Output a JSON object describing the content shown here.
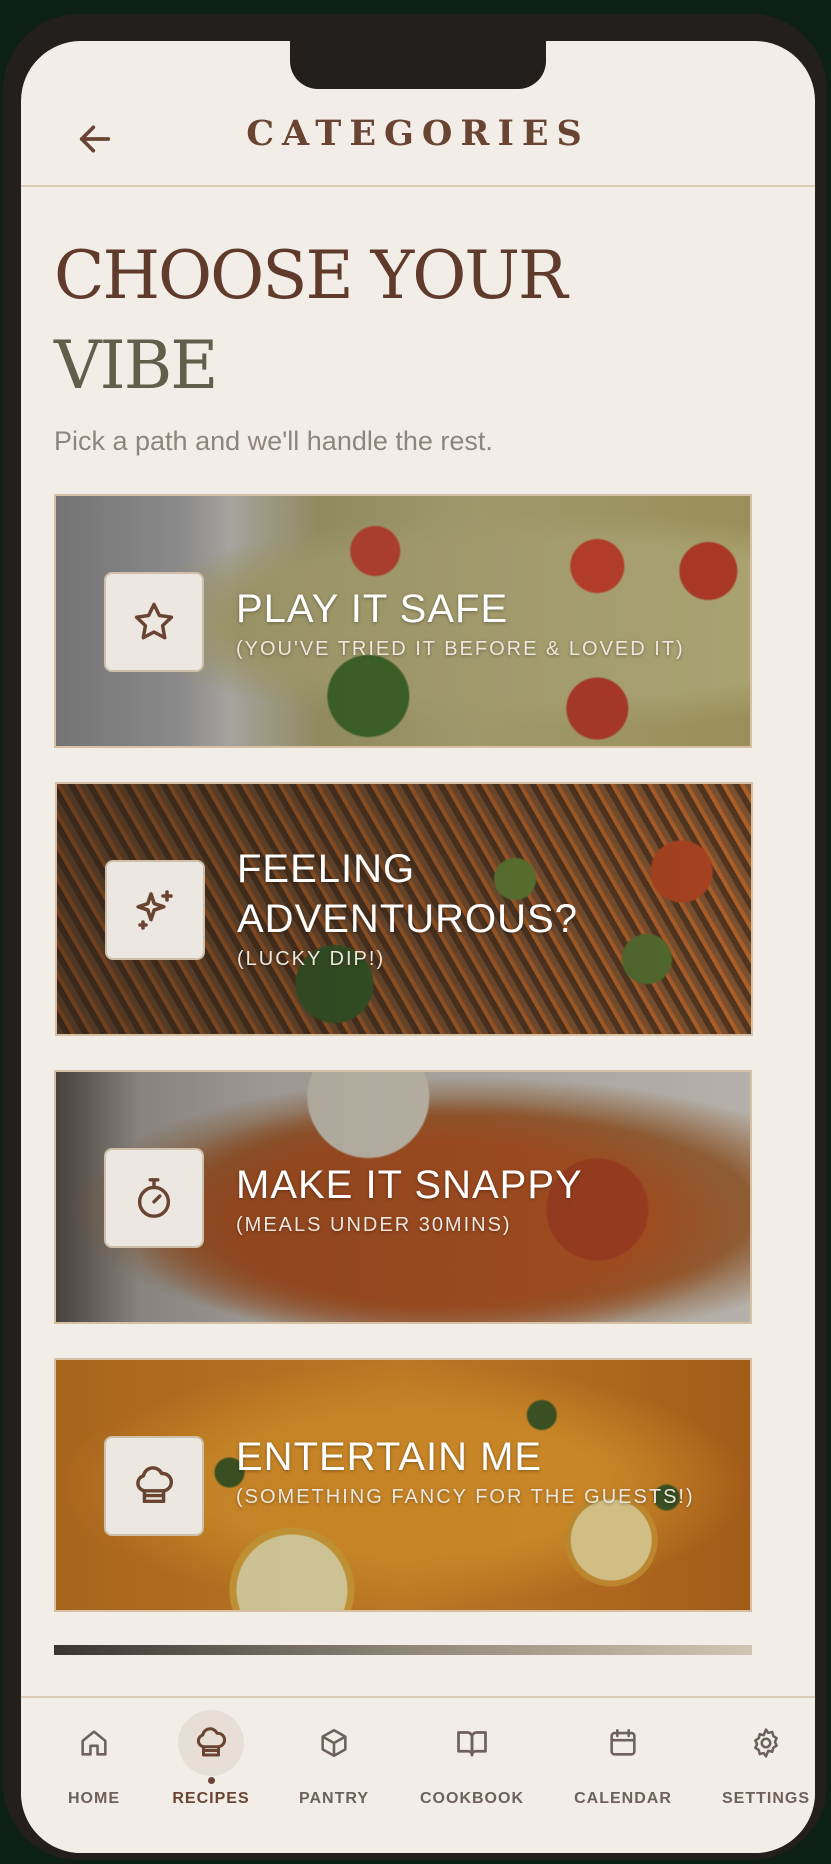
{
  "header": {
    "title": "CATEGORIES"
  },
  "hero": {
    "line1": "CHOOSE YOUR",
    "line2": "VIBE",
    "subtitle": "Pick a path and we'll handle the rest."
  },
  "cards": [
    {
      "title": "PLAY IT SAFE",
      "subtitle": "(YOU'VE TRIED IT BEFORE & LOVED IT)",
      "icon": "star-icon"
    },
    {
      "title": "FEELING ADVENTUROUS?",
      "subtitle": "(LUCKY DIP!)",
      "icon": "sparkles-icon"
    },
    {
      "title": "MAKE IT SNAPPY",
      "subtitle": "(MEALS UNDER 30MINS)",
      "icon": "stopwatch-icon"
    },
    {
      "title": "ENTERTAIN ME",
      "subtitle": "(SOMETHING FANCY FOR THE GUESTS!)",
      "icon": "chef-hat-icon"
    }
  ],
  "nav": [
    {
      "label": "HOME",
      "icon": "home-icon"
    },
    {
      "label": "RECIPES",
      "icon": "chef-hat-icon",
      "active": true
    },
    {
      "label": "PANTRY",
      "icon": "box-icon"
    },
    {
      "label": "COOKBOOK",
      "icon": "book-icon"
    },
    {
      "label": "CALENDAR",
      "icon": "calendar-icon"
    },
    {
      "label": "SETTINGS",
      "icon": "gear-icon"
    }
  ],
  "colors": {
    "accent_brown": "#6a4433",
    "olive": "#5f5f4a",
    "background": "#f2eee7"
  }
}
